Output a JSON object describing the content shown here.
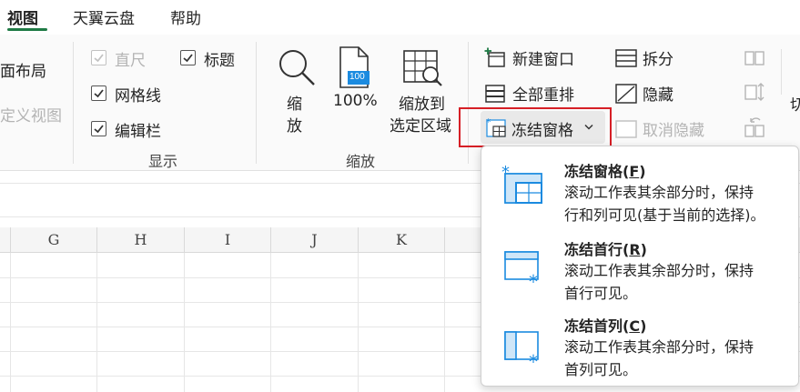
{
  "tabs": [
    {
      "label": "视图",
      "active": true
    },
    {
      "label": "天翼云盘",
      "active": false
    },
    {
      "label": "帮助",
      "active": false
    }
  ],
  "workbook_views": {
    "page_layout_partial": "面布局",
    "custom_views_partial": "定义视图"
  },
  "show_group": {
    "label": "显示",
    "ruler": {
      "label": "直尺",
      "checked": true,
      "disabled": true
    },
    "gridlines": {
      "label": "网格线",
      "checked": true
    },
    "formula_bar": {
      "label": "编辑栏",
      "checked": true
    },
    "headings": {
      "label": "标题",
      "checked": true
    }
  },
  "zoom_group": {
    "label": "缩放",
    "zoom_line1": "缩",
    "zoom_line2": "放",
    "zoom100_label": "100%",
    "zoom100_icon_text": "100",
    "zoom_selection_line1": "缩放到",
    "zoom_selection_line2": "选定区域"
  },
  "window_group": {
    "new_window": "新建窗口",
    "arrange_all": "全部重排",
    "freeze_panes": "冻结窗格",
    "split": "拆分",
    "hide": "隐藏",
    "unhide": "取消隐藏",
    "switch_partial": "切"
  },
  "columns": [
    "G",
    "H",
    "I",
    "J",
    "K"
  ],
  "freeze_menu": [
    {
      "title": "冻结窗格(F)",
      "title_main": "冻结窗格(",
      "title_key": "F",
      "title_end": ")",
      "desc1": "滚动工作表其余部分时，保持",
      "desc2": "行和列可见(基于当前的选择)。"
    },
    {
      "title": "冻结首行(R)",
      "title_main": "冻结首行(",
      "title_key": "R",
      "title_end": ")",
      "desc1": "滚动工作表其余部分时，保持",
      "desc2": "首行可见。"
    },
    {
      "title": "冻结首列(C)",
      "title_main": "冻结首列(",
      "title_key": "C",
      "title_end": ")",
      "desc1": "滚动工作表其余部分时，保持",
      "desc2": "首列可见。"
    }
  ],
  "colors": {
    "accent": "#1f7a45",
    "highlight_border": "#d61f26",
    "icon_blue": "#1b8be0"
  }
}
